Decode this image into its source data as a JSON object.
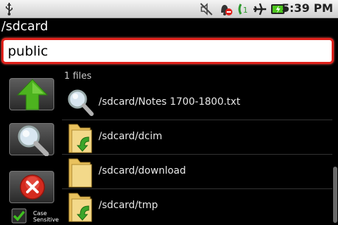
{
  "status_bar": {
    "time": "5:39 PM",
    "icons": [
      "usb-icon",
      "mute-icon",
      "alarm-off-icon",
      "call-forward-icon",
      "airplane-mode-icon",
      "battery-charging-icon"
    ]
  },
  "path_title": "/sdcard",
  "search": {
    "value": "public"
  },
  "toolbar": {
    "up_icon": "up-arrow-icon",
    "search_icon": "magnifier-icon",
    "clear_icon": "red-x-icon",
    "case_sensitive_label_1": "Case",
    "case_sensitive_label_2": "Sensitive",
    "case_sensitive_checked": true
  },
  "results": {
    "count_label": "1 files",
    "items": [
      {
        "icon": "magnifier-icon",
        "label": "/sdcard/Notes 1700-1800.txt"
      },
      {
        "icon": "folder-shortcut-icon",
        "label": "/sdcard/dcim"
      },
      {
        "icon": "folder-icon",
        "label": "/sdcard/download"
      },
      {
        "icon": "folder-shortcut-icon",
        "label": "/sdcard/tmp"
      }
    ]
  },
  "colors": {
    "accent": "#e0211b",
    "up_green": "#4db31f",
    "check_green": "#3fbf1f"
  }
}
